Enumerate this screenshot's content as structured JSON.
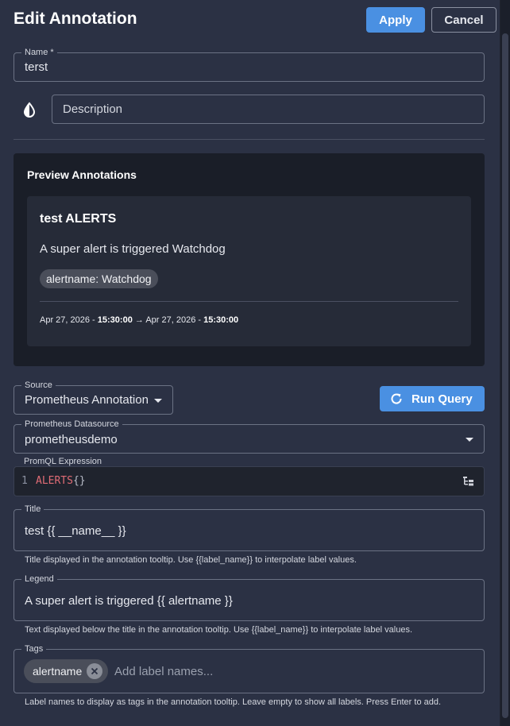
{
  "header": {
    "title": "Edit Annotation",
    "apply_label": "Apply",
    "cancel_label": "Cancel"
  },
  "name_field": {
    "label": "Name",
    "required_marker": "*",
    "value": "terst"
  },
  "description_field": {
    "placeholder": "Description",
    "value": "",
    "icon": "drop-half-icon"
  },
  "preview": {
    "heading": "Preview Annotations",
    "card_title": "test ALERTS",
    "card_description": "A super alert is triggered Watchdog",
    "chip": "alertname: Watchdog",
    "start_date": "Apr 27, 2026",
    "start_time": "15:30:00",
    "end_date": "Apr 27, 2026",
    "end_time": "15:30:00",
    "date_sep": " - ",
    "arrow": "→"
  },
  "source": {
    "label": "Source",
    "value": "Prometheus Annotation"
  },
  "run_query": {
    "label": "Run Query",
    "icon": "refresh-icon"
  },
  "datasource": {
    "label": "Prometheus Datasource",
    "value": "prometheusdemo"
  },
  "promql": {
    "label": "PromQL Expression",
    "line_number": "1",
    "keyword": "ALERTS",
    "braces": "{}"
  },
  "title_field": {
    "label": "Title",
    "value": "test {{ __name__ }}",
    "helper": "Title displayed in the annotation tooltip. Use {{label_name}} to interpolate label values."
  },
  "legend_field": {
    "label": "Legend",
    "value": "A super alert is triggered {{ alertname }}",
    "helper": "Text displayed below the title in the annotation tooltip. Use {{label_name}} to interpolate label values."
  },
  "tags_field": {
    "label": "Tags",
    "chips": [
      "alertname"
    ],
    "placeholder": "Add label names...",
    "helper": "Label names to display as tags in the annotation tooltip. Leave empty to show all labels. Press Enter to add."
  },
  "colors": {
    "accent": "#4a90e2",
    "background": "#2b3144",
    "panel": "#1a1e28",
    "keyword": "#e06c75"
  }
}
